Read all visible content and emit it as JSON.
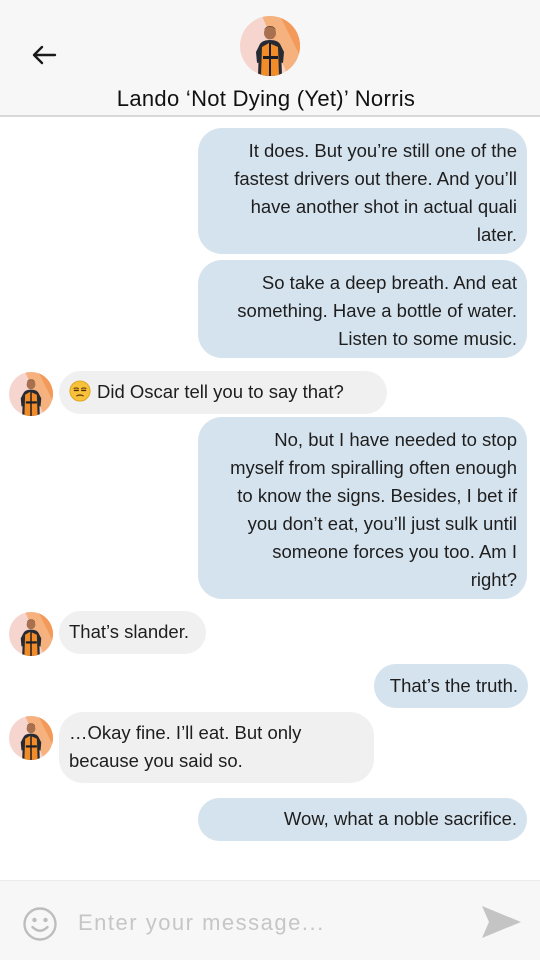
{
  "header": {
    "contact_name": "Lando ‘Not Dying (Yet)’ Norris",
    "back_icon": "arrow-left-icon",
    "avatar_icon": "contact-avatar"
  },
  "messages": [
    {
      "direction": "outgoing",
      "lines": [
        "It does. But you’re still one of the",
        "fastest drivers out there. And you’ll",
        "have another shot in actual quali",
        "later."
      ]
    },
    {
      "direction": "outgoing",
      "lines": [
        "So take a deep breath. And eat",
        "something. Have a bottle of water.",
        "Listen to some music."
      ]
    },
    {
      "direction": "incoming",
      "emoji": "unamused-face-emoji",
      "lines": [
        "Did Oscar tell you to say that?"
      ]
    },
    {
      "direction": "outgoing",
      "lines": [
        "No, but I have needed to stop",
        "myself from spiralling often enough",
        "to know the signs. Besides, I bet if",
        "you don’t eat, you’ll just sulk until",
        "someone forces you too. Am I",
        "right?"
      ]
    },
    {
      "direction": "incoming",
      "lines": [
        "That’s slander."
      ]
    },
    {
      "direction": "outgoing",
      "lines": [
        "That’s the truth."
      ]
    },
    {
      "direction": "incoming",
      "lines": [
        "…Okay fine. I’ll eat. But only",
        "because you said so."
      ]
    },
    {
      "direction": "outgoing",
      "lines": [
        "Wow, what a noble sacrifice."
      ]
    }
  ],
  "composer": {
    "placeholder": "Enter your message...",
    "value": "",
    "emoji_icon": "smiley-icon",
    "send_icon": "send-icon"
  },
  "colors": {
    "outgoing_bubble": "#d5e3ee",
    "incoming_bubble": "#f0f0f0",
    "header_bg": "#f7f7f7",
    "avatar_accent": "#f28c28"
  }
}
